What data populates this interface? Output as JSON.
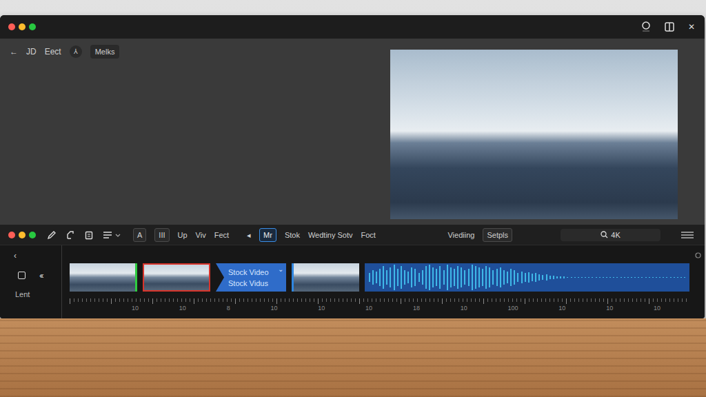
{
  "window": {
    "close": "✕"
  },
  "toolbar": {
    "items": [
      {
        "label": "←",
        "kind": "text"
      },
      {
        "label": "JD",
        "kind": "text"
      },
      {
        "label": "Eect",
        "kind": "text"
      },
      {
        "label": "⅄",
        "kind": "circle"
      },
      {
        "label": "Melks",
        "kind": "pill"
      }
    ]
  },
  "editor_toolbar": {
    "groups": [
      [
        {
          "label": "A",
          "kind": "box",
          "selected": false
        },
        {
          "label": "III",
          "kind": "box",
          "selected": false
        },
        {
          "label": "Up",
          "kind": "text",
          "selected": false
        },
        {
          "label": "Viv",
          "kind": "text",
          "selected": false
        },
        {
          "label": "Fect",
          "kind": "text",
          "selected": false
        }
      ],
      [
        {
          "label": "◂",
          "kind": "text",
          "selected": false
        },
        {
          "label": "Mr",
          "kind": "box",
          "selected": true
        },
        {
          "label": "Stok",
          "kind": "text",
          "selected": false
        },
        {
          "label": "Wedtiny Sotv",
          "kind": "text",
          "selected": false
        },
        {
          "label": "Foct",
          "kind": "text",
          "selected": false
        }
      ],
      [
        {
          "label": "Viediing",
          "kind": "text",
          "selected": false
        },
        {
          "label": "Setpls",
          "kind": "box",
          "selected": false
        }
      ]
    ],
    "search": {
      "text": "4K"
    }
  },
  "timeline": {
    "collapse": "‹",
    "rewind": "‹‹",
    "label": "Lent",
    "clips": [
      {
        "kind": "thumb",
        "edge": "right",
        "color": "#2ecc40"
      },
      {
        "kind": "thumb",
        "edge": "all",
        "color": "#d9342b"
      },
      {
        "kind": "title",
        "lines": [
          "Stock Video",
          "Stock Vidus"
        ],
        "caret": "⌄",
        "color": "#2f6cc9"
      },
      {
        "kind": "thumb",
        "edge": "left",
        "color": "#2f86e0"
      },
      {
        "kind": "audio",
        "color": "#1f4f9a",
        "waveform": [
          0.3,
          0.5,
          0.4,
          0.6,
          0.8,
          0.5,
          0.7,
          0.9,
          0.6,
          0.8,
          0.5,
          0.4,
          0.7,
          0.6,
          0.3,
          0.5,
          0.8,
          0.9,
          0.7,
          0.6,
          0.8,
          0.5,
          0.9,
          0.7,
          0.6,
          0.8,
          0.7,
          0.5,
          0.6,
          0.9,
          0.8,
          0.7,
          0.6,
          0.8,
          0.7,
          0.5,
          0.6,
          0.7,
          0.5,
          0.4,
          0.6,
          0.5,
          0.3,
          0.4,
          0.3,
          0.35,
          0.25,
          0.3,
          0.2,
          0.15,
          0.2,
          0.12,
          0.1,
          0.08,
          0.06,
          0.05,
          0.04,
          0.04,
          0.03,
          0.03,
          0.03,
          0.03,
          0.03,
          0.03,
          0.03,
          0.03,
          0.03,
          0.03,
          0.03,
          0.03,
          0.03,
          0.03,
          0.03,
          0.03,
          0.03,
          0.03,
          0.03,
          0.03,
          0.03,
          0.03,
          0.03,
          0.03,
          0.03,
          0.03,
          0.03,
          0.03,
          0.03,
          0.03,
          0.03,
          0.03
        ]
      }
    ],
    "ruler": [
      "10",
      "10",
      "8",
      "10",
      "10",
      "10",
      "18",
      "10",
      "100",
      "10",
      "10",
      "10"
    ]
  }
}
